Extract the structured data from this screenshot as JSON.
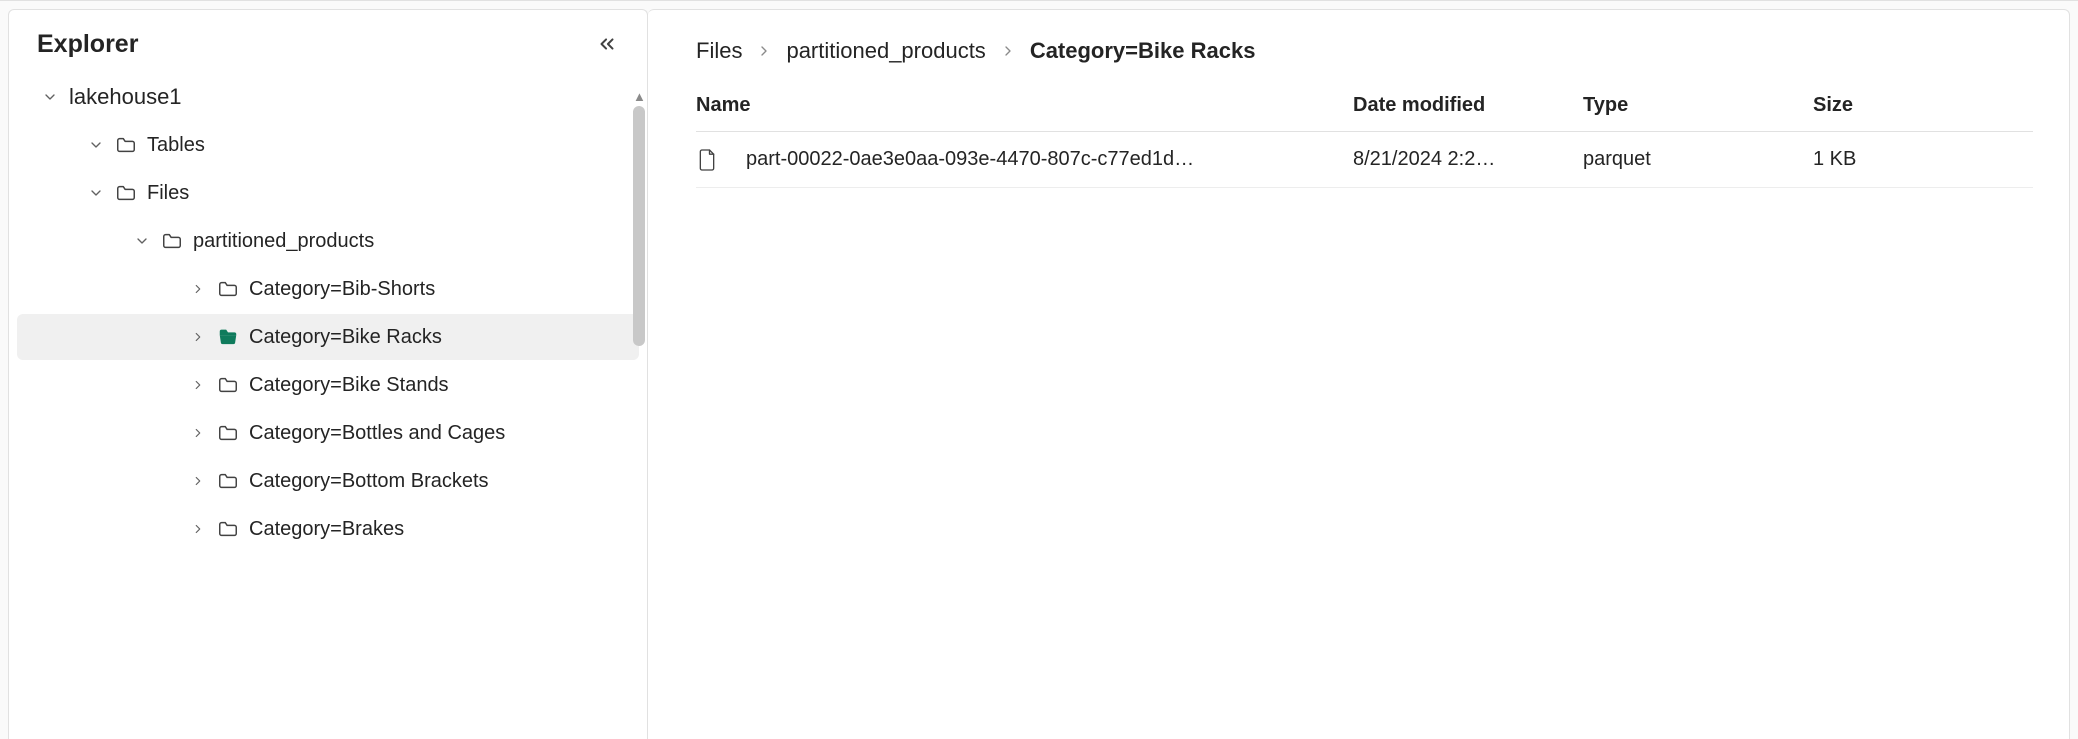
{
  "sidebar": {
    "title": "Explorer",
    "root": {
      "label": "lakehouse1"
    },
    "tables": {
      "label": "Tables"
    },
    "files": {
      "label": "Files"
    },
    "partitioned": {
      "label": "partitioned_products"
    },
    "folders": [
      {
        "label": "Category=Bib-Shorts",
        "selected": false
      },
      {
        "label": "Category=Bike Racks",
        "selected": true
      },
      {
        "label": "Category=Bike Stands",
        "selected": false
      },
      {
        "label": "Category=Bottles and Cages",
        "selected": false
      },
      {
        "label": "Category=Bottom Brackets",
        "selected": false
      },
      {
        "label": "Category=Brakes",
        "selected": false
      }
    ]
  },
  "breadcrumb": [
    {
      "label": "Files",
      "current": false
    },
    {
      "label": "partitioned_products",
      "current": false
    },
    {
      "label": "Category=Bike Racks",
      "current": true
    }
  ],
  "table": {
    "columns": [
      "Name",
      "Date modified",
      "Type",
      "Size"
    ],
    "rows": [
      {
        "name": "part-00022-0ae3e0aa-093e-4470-807c-c77ed1d…",
        "date": "8/21/2024 2:2…",
        "type": "parquet",
        "size": "1 KB"
      }
    ]
  }
}
